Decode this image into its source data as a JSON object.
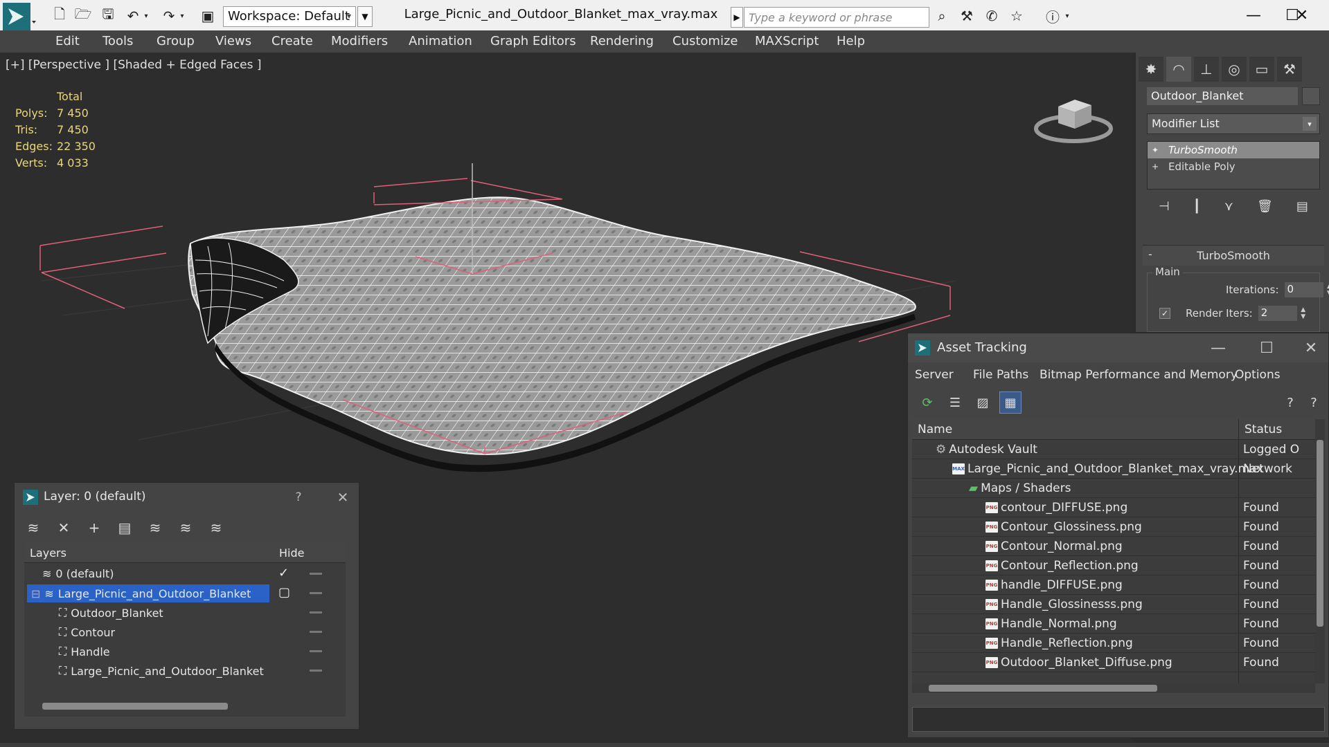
{
  "app": {
    "workspace_label": "Workspace: Default",
    "filename": "Large_Picnic_and_Outdoor_Blanket_max_vray.max",
    "search_placeholder": "Type a keyword or phrase"
  },
  "menu": [
    "Edit",
    "Tools",
    "Group",
    "Views",
    "Create",
    "Modifiers",
    "Animation",
    "Graph Editors",
    "Rendering",
    "Customize",
    "MAXScript",
    "Help"
  ],
  "viewport": {
    "label": "[+] [Perspective ] [Shaded + Edged Faces ]",
    "stats_header": "Total",
    "stats": [
      {
        "k": "Polys:",
        "v": "7 450"
      },
      {
        "k": "Tris:",
        "v": "7 450"
      },
      {
        "k": "Edges:",
        "v": "22 350"
      },
      {
        "k": "Verts:",
        "v": "4 033"
      }
    ]
  },
  "command_panel": {
    "object_name": "Outdoor_Blanket",
    "modifier_list": "Modifier List",
    "stack": [
      "TurboSmooth",
      "Editable Poly"
    ],
    "rollout_title": "TurboSmooth",
    "group_label": "Main",
    "iterations_label": "Iterations:",
    "iterations_value": "0",
    "render_iters_label": "Render Iters:",
    "render_iters_value": "2",
    "render_iters_checked": true
  },
  "asset_tracking": {
    "title": "Asset Tracking",
    "menus": [
      "Server",
      "File",
      "Paths",
      "Bitmap Performance and Memory",
      "Options"
    ],
    "col_name": "Name",
    "col_status": "Status",
    "rows": [
      {
        "name": "Autodesk Vault",
        "status": "Logged O",
        "indent": 0,
        "icon": "vault"
      },
      {
        "name": "Large_Picnic_and_Outdoor_Blanket_max_vray.max",
        "status": "Network",
        "indent": 1,
        "icon": "max"
      },
      {
        "name": "Maps / Shaders",
        "status": "",
        "indent": 2,
        "icon": "maps"
      },
      {
        "name": "contour_DIFFUSE.png",
        "status": "Found",
        "indent": 3,
        "icon": "png"
      },
      {
        "name": "Contour_Glossiness.png",
        "status": "Found",
        "indent": 3,
        "icon": "png"
      },
      {
        "name": "Contour_Normal.png",
        "status": "Found",
        "indent": 3,
        "icon": "png"
      },
      {
        "name": "Contour_Reflection.png",
        "status": "Found",
        "indent": 3,
        "icon": "png"
      },
      {
        "name": "handle_DIFFUSE.png",
        "status": "Found",
        "indent": 3,
        "icon": "png"
      },
      {
        "name": "Handle_Glossinesss.png",
        "status": "Found",
        "indent": 3,
        "icon": "png"
      },
      {
        "name": "Handle_Normal.png",
        "status": "Found",
        "indent": 3,
        "icon": "png"
      },
      {
        "name": "Handle_Reflection.png",
        "status": "Found",
        "indent": 3,
        "icon": "png"
      },
      {
        "name": "Outdoor_Blanket_Diffuse.png",
        "status": "Found",
        "indent": 3,
        "icon": "png"
      }
    ],
    "png_icon_text": "PNG",
    "max_icon_text": "MAX"
  },
  "layer_explorer": {
    "title": "Layer: 0 (default)",
    "help": "?",
    "col_layers": "Layers",
    "col_hide": "Hide",
    "rows": [
      {
        "name": "0 (default)",
        "indent": 1,
        "kind": "layer",
        "current": true,
        "selected": false
      },
      {
        "name": "Large_Picnic_and_Outdoor_Blanket",
        "indent": 0,
        "kind": "layer",
        "current": false,
        "selected": true
      },
      {
        "name": "Outdoor_Blanket",
        "indent": 2,
        "kind": "object",
        "current": false,
        "selected": false
      },
      {
        "name": "Contour",
        "indent": 2,
        "kind": "object",
        "current": false,
        "selected": false
      },
      {
        "name": "Handle",
        "indent": 2,
        "kind": "object",
        "current": false,
        "selected": false
      },
      {
        "name": "Large_Picnic_and_Outdoor_Blanket",
        "indent": 2,
        "kind": "object",
        "current": false,
        "selected": false
      }
    ]
  },
  "colors": {
    "accent_blue": "#2a62c8",
    "stats_yellow": "#e8d77a",
    "bbox_pink": "#e0607a"
  }
}
